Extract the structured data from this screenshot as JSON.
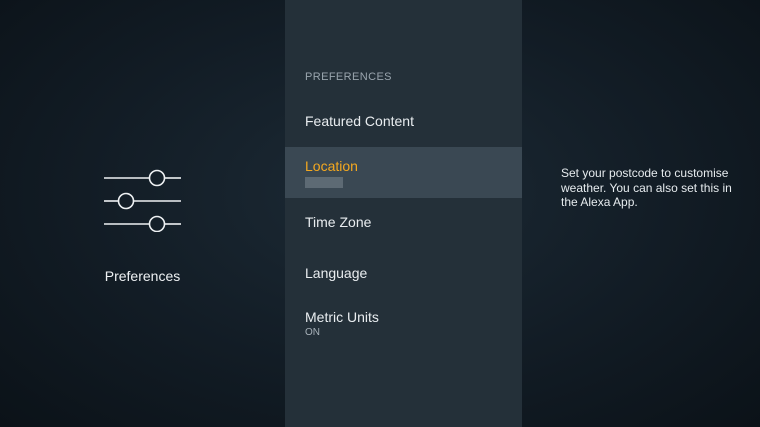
{
  "left_panel": {
    "icon": "sliders-icon",
    "title": "Preferences"
  },
  "menu": {
    "section_header": "PREFERENCES",
    "items": [
      {
        "label": "Featured Content",
        "sub": ""
      },
      {
        "label": "Location",
        "sub": "",
        "selected": true
      },
      {
        "label": "Time Zone",
        "sub": ""
      },
      {
        "label": "Language",
        "sub": ""
      },
      {
        "label": "Metric Units",
        "sub": "ON"
      }
    ]
  },
  "description": {
    "text": "Set your postcode to customise weather. You can also set this in the Alexa App."
  },
  "colors": {
    "accent": "#f4a81f",
    "menu_background": "#243039",
    "selected_background": "#3a4853"
  }
}
